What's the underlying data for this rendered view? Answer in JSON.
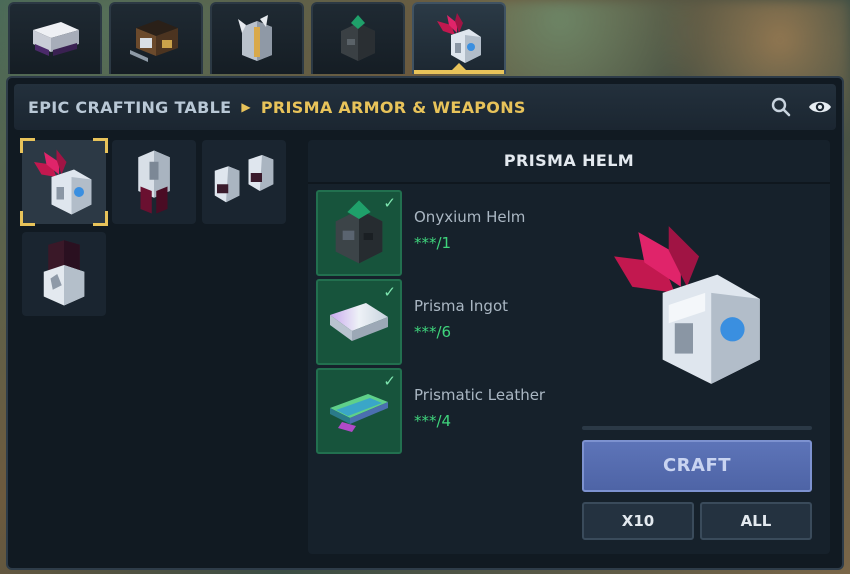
{
  "tabs": [
    {
      "icon": "crafting-table-icon",
      "active": false
    },
    {
      "icon": "furnace-icon",
      "active": false
    },
    {
      "icon": "silver-chestplate-icon",
      "active": false
    },
    {
      "icon": "onyxium-helm-icon",
      "active": false
    },
    {
      "icon": "prisma-helm-icon",
      "active": true
    }
  ],
  "header": {
    "root": "EPIC CRAFTING TABLE",
    "category": "PRISMA ARMOR & WEAPONS",
    "search_icon": "search-icon",
    "view_icon": "eye-icon"
  },
  "items": [
    {
      "icon": "prisma-helm-icon",
      "selected": true
    },
    {
      "icon": "prisma-chestplate-icon",
      "selected": false
    },
    {
      "icon": "prisma-leggings-icon",
      "selected": false
    },
    {
      "icon": "prisma-boots-icon",
      "selected": false
    }
  ],
  "recipe": {
    "title": "PRISMA HELM",
    "ingredients": [
      {
        "name": "Onyxium Helm",
        "qty": "***/1",
        "icon": "onyxium-helm-icon",
        "available": true
      },
      {
        "name": "Prisma Ingot",
        "qty": "***/6",
        "icon": "prisma-ingot-icon",
        "available": true
      },
      {
        "name": "Prismatic Leather",
        "qty": "***/4",
        "icon": "prismatic-leather-icon",
        "available": true
      }
    ],
    "preview_icon": "prisma-helm-icon",
    "craft_label": "CRAFT",
    "x10_label": "X10",
    "all_label": "ALL",
    "check_glyph": "✓"
  },
  "colors": {
    "accent": "#e8c35a",
    "craft": "#5d74b8",
    "ingredient_ok": "#17543c",
    "qty_text": "#3fd47c"
  }
}
